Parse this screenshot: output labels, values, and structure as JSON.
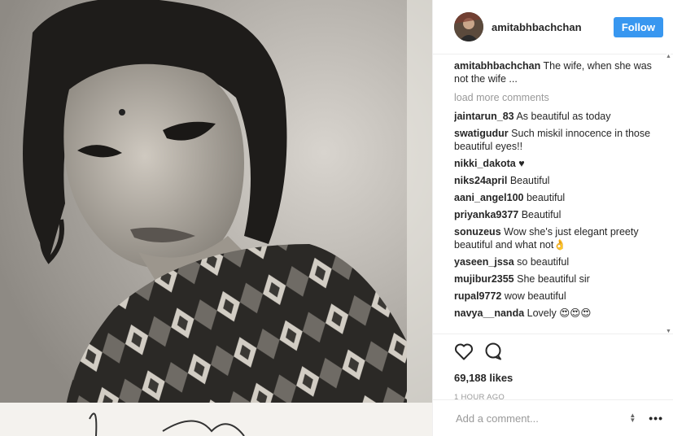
{
  "header": {
    "username": "amitabhbachchan",
    "follow_label": "Follow"
  },
  "caption": {
    "username": "amitabhbachchan",
    "text": "The wife, when she was not the wife ..."
  },
  "load_more": "load more comments",
  "comments": [
    {
      "user": "jaintarun_83",
      "text": "As beautiful as today"
    },
    {
      "user": "swatigudur",
      "text": "Such miskil innocence in those beautiful eyes!!"
    },
    {
      "user": "nikki_dakota",
      "text": "♥"
    },
    {
      "user": "niks24april",
      "text": "Beautiful"
    },
    {
      "user": "aani_angel100",
      "text": "beautiful"
    },
    {
      "user": "priyanka9377",
      "text": "Beautiful"
    },
    {
      "user": "sonuzeus",
      "text": "Wow she's just elegant preety beautiful and what not👌"
    },
    {
      "user": "yaseen_jssa",
      "text": "so beautiful"
    },
    {
      "user": "mujibur2355",
      "text": "She beautiful sir"
    },
    {
      "user": "rupal9772",
      "text": "wow beautiful"
    },
    {
      "user": "navya__nanda",
      "text": "Lovely 😍😍😍"
    }
  ],
  "likes": "69,188 likes",
  "time": "1 HOUR AGO",
  "add_comment_placeholder": "Add a comment...",
  "icons": {
    "like": "heart-icon",
    "comment": "comment-icon",
    "more": "more-options-icon"
  },
  "colors": {
    "follow_button": "#3897f0",
    "secondary_text": "#999999"
  }
}
